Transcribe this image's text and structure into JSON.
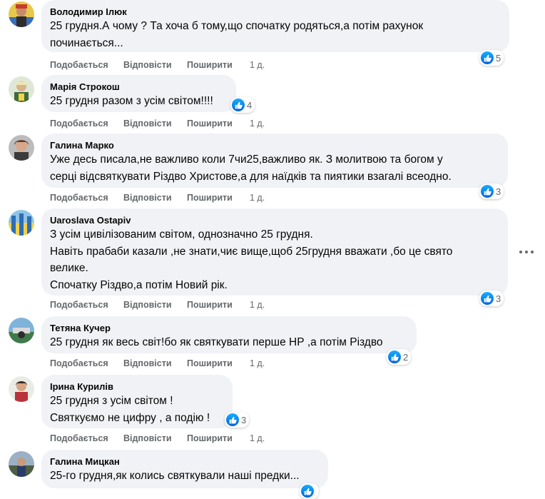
{
  "comments": [
    {
      "author": "Володимир Ілюк",
      "lines": [
        "25 грудня.А чому ? Та хоча б тому,що спочатку родяться,а потім рахунок",
        "починається..."
      ],
      "reactions": "5",
      "time": "1 д."
    },
    {
      "author": "Марія Строкош",
      "lines": [
        "25 грудня разом з усім світом!!!!"
      ],
      "reactions": "4",
      "time": "1 д."
    },
    {
      "author": "Галина Марко",
      "lines": [
        "Уже десь писала,не важливо коли 7чи25,важливо як. З молитвою та богом у",
        "серці відсвяткувати Різдво Христове,а для наїдків та пиятики взагалі всеодно."
      ],
      "reactions": "3",
      "time": "1 д."
    },
    {
      "author": "Uaroslava Ostapiv",
      "lines": [
        "З усім цивілізованим світом, однозначно 25 грудня.",
        "Навіть прабаби казали ,не знати,чиє вище,щоб 25грудня вважати ,бо це свято",
        "велике.",
        "Спочатку Різдво,а потім Новий рік."
      ],
      "reactions": "3",
      "time": "1 д."
    },
    {
      "author": "Тетяна Кучер",
      "lines": [
        "25 грудня як весь світ!бо як святкувати перше НР ,а потім Різдво"
      ],
      "reactions": "2",
      "time": "1 д."
    },
    {
      "author": "Ірина Курилів",
      "lines": [
        "25 грудня з усім світом !",
        "Святкуємо не цифру , а подію !"
      ],
      "reactions": "3",
      "time": "1 д."
    },
    {
      "author": "Галина Мицкан",
      "lines": [
        "25-го грудня,як колись святкували наші предки..."
      ],
      "reactions": "",
      "time": ""
    }
  ],
  "actions": {
    "like": "Подобається",
    "reply": "Відповісти",
    "share": "Поширити"
  },
  "icons": {
    "reaction": "like-reaction-icon",
    "more": "more-options-icon"
  },
  "colors": {
    "bubble": "#f0f2f5",
    "secondary_text": "#65676b",
    "like_blue": "#1877f2"
  }
}
